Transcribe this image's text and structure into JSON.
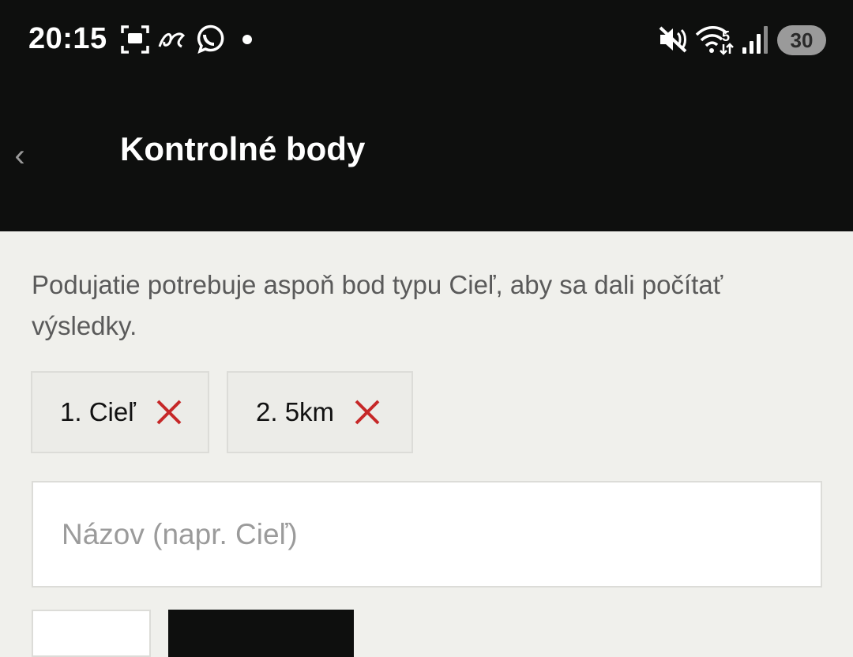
{
  "status_bar": {
    "time": "20:15",
    "battery": "30",
    "network_badge": "5",
    "icons": [
      "screenshot-icon",
      "ai-icon",
      "whatsapp-icon",
      "notification-dot-icon",
      "mute-icon",
      "wifi-icon",
      "signal-icon",
      "battery-icon"
    ]
  },
  "app_bar": {
    "title": "Kontrolné body",
    "back_glyph": "‹"
  },
  "info_text": "Podujatie potrebuje aspoň bod typu Cieľ, aby sa dali počítať výsledky.",
  "chips": [
    {
      "label": "1. Cieľ"
    },
    {
      "label": "2. 5km"
    }
  ],
  "name_field": {
    "placeholder": "Názov (napr. Cieľ)",
    "value": ""
  },
  "colors": {
    "dark": "#0e0f0e",
    "background": "#f0f0ec",
    "remove": "#c62828"
  }
}
